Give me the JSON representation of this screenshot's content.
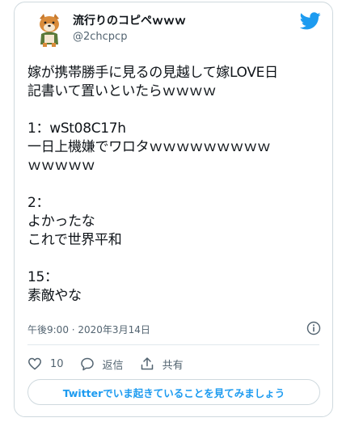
{
  "user": {
    "display_name": "流行りのコピペｗｗｗ",
    "handle": "@2chcpcp",
    "avatar_icon": "shiba-dog-avatar"
  },
  "tweet": {
    "text": "嫁が携帯勝手に見るの見越して嫁LOVE日\n記書いて置いといたらｗｗｗｗ\n\n1：wSt08C17h\n一日上機嫌でワロタｗｗｗｗｗｗｗｗｗ\nｗｗｗｗｗ\n\n2：\nよかったな\nこれで世界平和\n\n15：\n素敵やな",
    "timestamp": "午後9:00 · 2020年3月14日"
  },
  "actions": {
    "like_count": "10",
    "reply_label": "返信",
    "share_label": "共有"
  },
  "cta_label": "Twitterでいま起きていることを見てみましょう",
  "colors": {
    "brand": "#1d9bf0",
    "text": "#0f1419",
    "muted": "#536471",
    "border": "#cfd9de"
  },
  "icons": [
    "twitter-bird-icon",
    "info-icon",
    "heart-icon",
    "reply-icon",
    "share-icon"
  ]
}
